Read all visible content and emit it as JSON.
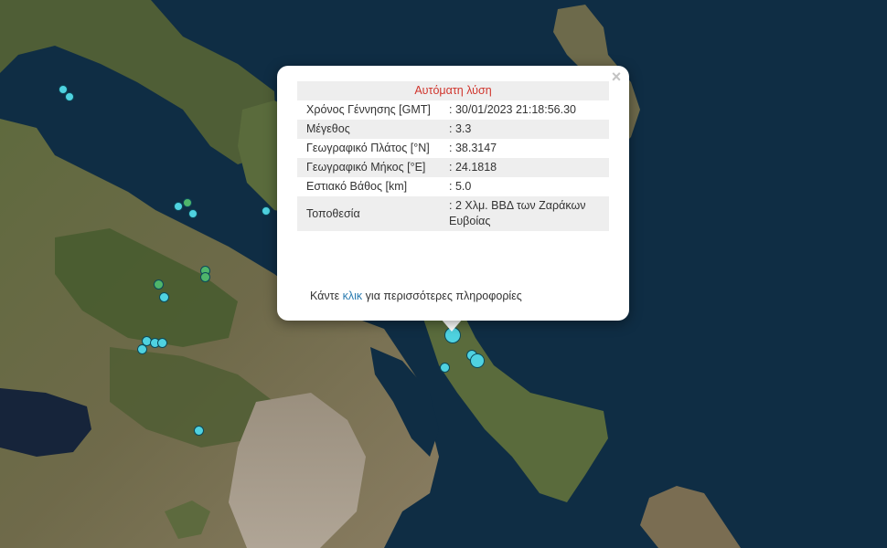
{
  "popup": {
    "title": "Αυτόματη λύση",
    "close_symbol": "×",
    "rows": [
      {
        "label": "Χρόνος Γέννησης [GMT]",
        "value": ": 30/01/2023 21:18:56.30"
      },
      {
        "label": "Μέγεθος",
        "value": ": 3.3"
      },
      {
        "label": "Γεωγραφικό Πλάτος [°N]",
        "value": ": 38.3147"
      },
      {
        "label": "Γεωγραφικό Μήκος [°E]",
        "value": ": 24.1818"
      },
      {
        "label": "Εστιακό Βάθος [km]",
        "value": ": 5.0"
      },
      {
        "label": "Τοποθεσία",
        "value": ": 2 Χλμ. ΒΒΔ των Ζαράκων Ευβοίας"
      }
    ],
    "more_prefix": "Κάντε ",
    "more_link": "κλικ",
    "more_suffix": " για περισσότερες πληροφορίες"
  },
  "colors": {
    "sea": "#0f2d44",
    "land": "#5a5a3c",
    "marker_cyan": "#4fd2e0",
    "marker_green": "#4fb56b",
    "header_red": "#d0342c",
    "link_blue": "#2a7bb0"
  },
  "icons": {
    "close": "close-icon",
    "marker": "earthquake-marker-icon"
  }
}
